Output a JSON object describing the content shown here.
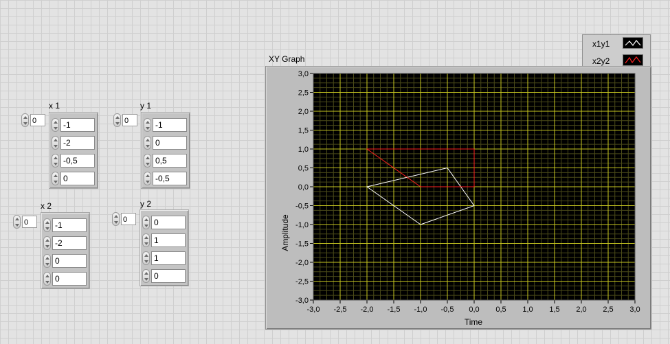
{
  "controls": [
    {
      "label": "x 1",
      "index": "0",
      "values": [
        "-1",
        "-2",
        "-0,5",
        "0"
      ]
    },
    {
      "label": "y 1",
      "index": "0",
      "values": [
        "-1",
        "0",
        "0,5",
        "-0,5"
      ]
    },
    {
      "label": "x 2",
      "index": "0",
      "values": [
        "-1",
        "-2",
        "0",
        "0"
      ]
    },
    {
      "label": "y 2",
      "index": "0",
      "values": [
        "0",
        "1",
        "1",
        "0"
      ]
    }
  ],
  "graph": {
    "title": "XY Graph",
    "xlabel": "Time",
    "ylabel": "Amplitude",
    "legend": [
      {
        "name": "x1y1",
        "color": "#ffffff"
      },
      {
        "name": "x2y2",
        "color": "#ff2020"
      }
    ],
    "x_ticks": [
      "-3,0",
      "-2,5",
      "-2,0",
      "-1,5",
      "-1,0",
      "-0,5",
      "0,0",
      "0,5",
      "1,0",
      "1,5",
      "2,0",
      "2,5",
      "3,0"
    ],
    "y_ticks": [
      "3,0",
      "2,5",
      "2,0",
      "1,5",
      "1,0",
      "0,5",
      "0,0",
      "-0,5",
      "-1,0",
      "-1,5",
      "-2,0",
      "-2,5",
      "-3,0"
    ]
  },
  "chart_data": {
    "type": "scatter",
    "title": "XY Graph",
    "xlabel": "Time",
    "ylabel": "Amplitude",
    "xlim": [
      -3,
      3
    ],
    "ylim": [
      -3,
      3
    ],
    "grid": true,
    "legend": "top-right",
    "series": [
      {
        "name": "x1y1",
        "color": "#ffffff",
        "x": [
          -1,
          -2,
          -0.5,
          0,
          -1
        ],
        "y": [
          -1,
          0,
          0.5,
          -0.5,
          -1
        ]
      },
      {
        "name": "x2y2",
        "color": "#ff2020",
        "x": [
          -1,
          -2,
          0,
          0,
          -1
        ],
        "y": [
          0,
          1,
          1,
          0,
          0
        ]
      }
    ]
  }
}
